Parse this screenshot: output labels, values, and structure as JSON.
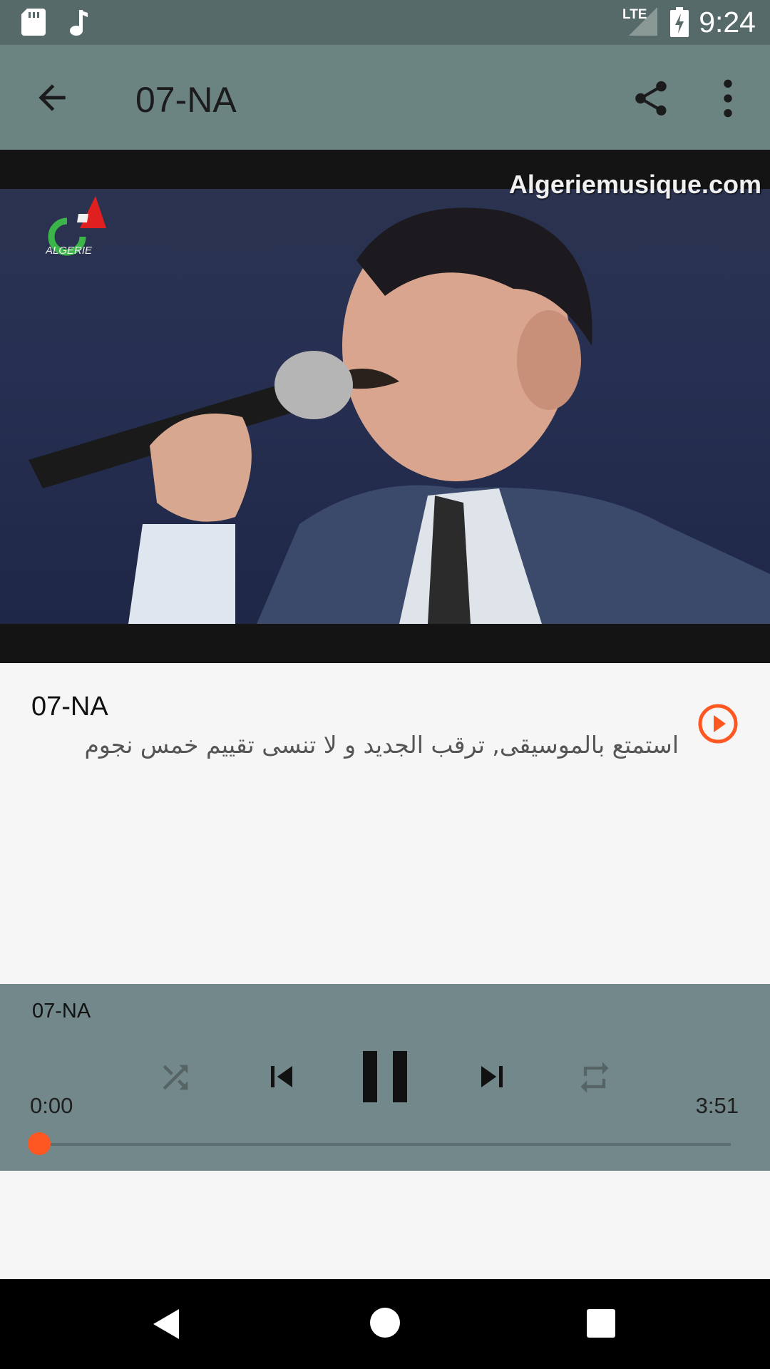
{
  "status_bar": {
    "network": "LTE",
    "time": "9:24",
    "icons": [
      "sd-card-icon",
      "music-note-icon",
      "signal-icon",
      "battery-charging-icon"
    ]
  },
  "app_bar": {
    "title": "07-NA",
    "icons": [
      "arrow-back-icon",
      "share-icon",
      "more-vert-icon"
    ]
  },
  "video": {
    "watermark": "Algeriemusique.com",
    "logo_text": "ALGERIE"
  },
  "track": {
    "title": "07-NA",
    "subtitle": "استمتع بالموسيقى, ترقب الجديد و لا تنسى تقييم خمس نجوم"
  },
  "player": {
    "title": "07-NA",
    "elapsed": "0:00",
    "duration": "3:51",
    "progress": 0.0,
    "shuffle_enabled": false,
    "repeat_enabled": false
  },
  "colors": {
    "status_bar": "#566b69",
    "app_bar": "#6b8482",
    "player_panel": "#73888a",
    "accent": "#ff5722",
    "background": "#f6f6f6"
  }
}
